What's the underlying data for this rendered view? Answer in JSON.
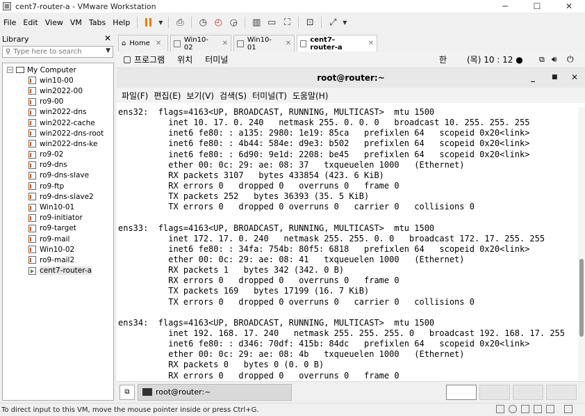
{
  "window": {
    "title": "cent7-router-a - VMware Workstation"
  },
  "menu": {
    "items": [
      "File",
      "Edit",
      "View",
      "VM",
      "Tabs",
      "Help"
    ]
  },
  "library": {
    "title": "Library",
    "search_placeholder": "Type here to search",
    "root": "My Computer",
    "vms": [
      "win10-00",
      "win2022-00",
      "ro9-00",
      "win2022-dns",
      "win2022-cache",
      "win2022-dns-root",
      "win2022-dns-ke",
      "ro9-02",
      "ro9-dns",
      "ro9-dns-slave",
      "ro9-ftp",
      "ro9-dns-slave2",
      "Win10-01",
      "ro9-initiator",
      "ro9-target",
      "ro9-mail",
      "Win10-02",
      "ro9-mail2",
      "cent7-router-a"
    ],
    "selected": "cent7-router-a"
  },
  "tabs": [
    {
      "label": "Home"
    },
    {
      "label": "Win10-02"
    },
    {
      "label": "Win10-01"
    },
    {
      "label": "cent7-router-a",
      "active": true
    }
  ],
  "gnome": {
    "applications": "프로그램",
    "places": "위치",
    "terminal": "터미널",
    "input_method": "한",
    "clock": "(목) 10 : 12 ●"
  },
  "terminal_window": {
    "title": "root@router:~",
    "menus": [
      "파일(F)",
      "편집(E)",
      "보기(V)",
      "검색(S)",
      "터미널(T)",
      "도움말(H)"
    ]
  },
  "terminal_lines": [
    "ens32:  flags=4163<UP, BROADCAST, RUNNING, MULTICAST>  mtu 1500",
    "          inet 10. 17. 0. 240   netmask 255. 0. 0. 0   broadcast 10. 255. 255. 255",
    "          inet6 fe80: : a135: 2980: 1e19: 85ca   prefixlen 64   scopeid 0x20<link>",
    "          inet6 fe80: : 4b44: 584e: d9e3: b502   prefixlen 64   scopeid 0x20<link>",
    "          inet6 fe80: : 6d90: 9e1d: 2208: be45   prefixlen 64   scopeid 0x20<link>",
    "          ether 00: 0c: 29: ae: 08: 37   txqueuelen 1000   (Ethernet)",
    "          RX packets 3107   bytes 433854 (423. 6 KiB)",
    "          RX errors 0   dropped 0   overruns 0   frame 0",
    "          TX packets 252   bytes 36393 (35. 5 KiB)",
    "          TX errors 0   dropped 0 overruns 0   carrier 0   collisions 0",
    "",
    "ens33:  flags=4163<UP, BROADCAST, RUNNING, MULTICAST>  mtu 1500",
    "          inet 172. 17. 0. 240   netmask 255. 255. 0. 0   broadcast 172. 17. 255. 255",
    "          inet6 fe80: : 34fa: 754b: 80f5: 6818   prefixlen 64   scopeid 0x20<link>",
    "          ether 00: 0c: 29: ae: 08: 41   txqueuelen 1000   (Ethernet)",
    "          RX packets 1   bytes 342 (342. 0 B)",
    "          RX errors 0   dropped 0   overruns 0   frame 0",
    "          TX packets 169   bytes 17199 (16. 7 KiB)",
    "          TX errors 0   dropped 0 overruns 0   carrier 0   collisions 0",
    "",
    "ens34:  flags=4163<UP, BROADCAST, RUNNING, MULTICAST>  mtu 1500",
    "          inet 192. 168. 17. 240   netmask 255. 255. 255. 0   broadcast 192. 168. 17. 255",
    "          inet6 fe80: : d346: 70df: 415b: 84dc   prefixlen 64   scopeid 0x20<link>",
    "          ether 00: 0c: 29: ae: 08: 4b   txqueuelen 1000   (Ethernet)",
    "          RX packets 0   bytes 0 (0. 0 B)",
    "          RX errors 0   dropped 0   overruns 0   frame 0"
  ],
  "taskbar": {
    "item": "root@router:~"
  },
  "statusbar": {
    "text": "To direct input to this VM, move the mouse pointer inside or press Ctrl+G."
  },
  "colors": {
    "suspend_orange": "#e07b00",
    "running_green": "#2e9e2e",
    "scrollbar": "#9a9a9a"
  }
}
